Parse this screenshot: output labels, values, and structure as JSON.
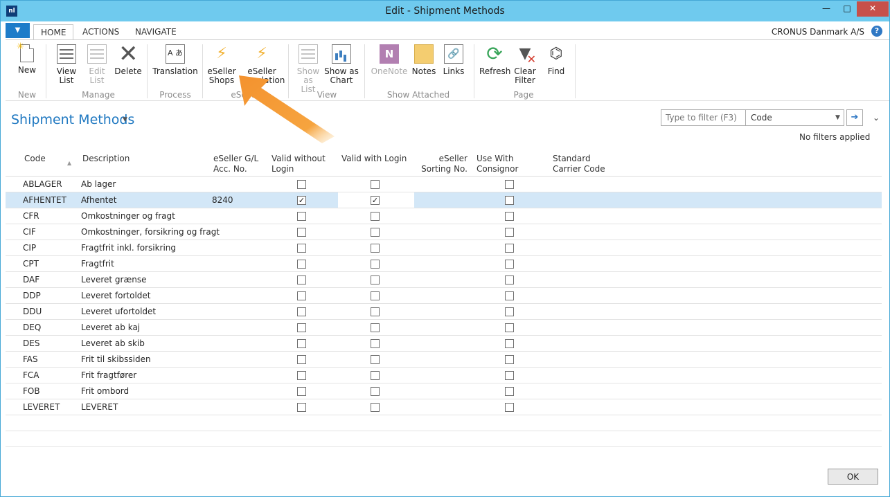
{
  "window": {
    "title": "Edit - Shipment Methods",
    "min_glyph": "—",
    "max_glyph": "□",
    "close_glyph": "✕"
  },
  "tabs": {
    "menu_glyph": "▼",
    "home": "HOME",
    "actions": "ACTIONS",
    "navigate": "NAVIGATE"
  },
  "company": "CRONUS Danmark A/S",
  "help_glyph": "?",
  "ribbon": {
    "new": "New",
    "view_list": [
      "View",
      "List"
    ],
    "edit_list": [
      "Edit",
      "List"
    ],
    "delete": "Delete",
    "translation": "Translation",
    "eseller_shops": [
      "eSeller",
      "Shops"
    ],
    "eseller_translation": [
      "eSeller",
      "Translation"
    ],
    "show_as_list": [
      "Show",
      "as List"
    ],
    "show_as_chart": [
      "Show as",
      "Chart"
    ],
    "onenote": "OneNote",
    "notes": "Notes",
    "links": "Links",
    "refresh": "Refresh",
    "clear_filter": [
      "Clear",
      "Filter"
    ],
    "find": "Find",
    "groups": {
      "new": "New",
      "manage": "Manage",
      "process": "Process",
      "eseller": "eSeller",
      "view": "View",
      "show_attached": "Show Attached",
      "page": "Page"
    },
    "icons": {
      "new": "new-document-icon",
      "view_list": "view-list-icon",
      "edit_list": "edit-list-icon",
      "delete": "delete-x-icon",
      "translation": "translation-icon",
      "eseller": "lightning-bolt-icon",
      "show_as_list": "list-view-icon",
      "show_as_chart": "chart-icon",
      "onenote": "onenote-icon",
      "notes": "sticky-note-icon",
      "links": "link-icon",
      "refresh": "refresh-icon",
      "clear_filter": "clear-filter-icon",
      "find": "binoculars-icon"
    }
  },
  "page": {
    "title": "Shipment Methods",
    "filter": {
      "placeholder": "Type to filter (F3)",
      "field": "Code",
      "status": "No filters applied"
    }
  },
  "grid": {
    "columns": [
      [
        "Code",
        ""
      ],
      [
        "Description",
        ""
      ],
      [
        "eSeller G/L",
        "Acc. No."
      ],
      [
        "Valid without",
        "Login"
      ],
      [
        "Valid with Login",
        ""
      ],
      [
        "eSeller",
        "Sorting No."
      ],
      [
        "Use With",
        "Consignor"
      ],
      [
        "Standard",
        "Carrier Code"
      ]
    ],
    "rows": [
      {
        "code": "ABLAGER",
        "description": "Ab lager",
        "acc_no": "",
        "valid_without_login": false,
        "valid_with_login": false,
        "use_with_consignor": false,
        "selected": false
      },
      {
        "code": "AFHENTET",
        "description": "Afhentet",
        "acc_no": "8240",
        "valid_without_login": true,
        "valid_with_login": true,
        "use_with_consignor": false,
        "selected": true
      },
      {
        "code": "CFR",
        "description": "Omkostninger og fragt",
        "acc_no": "",
        "valid_without_login": false,
        "valid_with_login": false,
        "use_with_consignor": false,
        "selected": false
      },
      {
        "code": "CIF",
        "description": "Omkostninger, forsikring og fragt",
        "acc_no": "",
        "valid_without_login": false,
        "valid_with_login": false,
        "use_with_consignor": false,
        "selected": false
      },
      {
        "code": "CIP",
        "description": "Fragtfrit inkl. forsikring",
        "acc_no": "",
        "valid_without_login": false,
        "valid_with_login": false,
        "use_with_consignor": false,
        "selected": false
      },
      {
        "code": "CPT",
        "description": "Fragtfrit",
        "acc_no": "",
        "valid_without_login": false,
        "valid_with_login": false,
        "use_with_consignor": false,
        "selected": false
      },
      {
        "code": "DAF",
        "description": "Leveret grænse",
        "acc_no": "",
        "valid_without_login": false,
        "valid_with_login": false,
        "use_with_consignor": false,
        "selected": false
      },
      {
        "code": "DDP",
        "description": "Leveret fortoldet",
        "acc_no": "",
        "valid_without_login": false,
        "valid_with_login": false,
        "use_with_consignor": false,
        "selected": false
      },
      {
        "code": "DDU",
        "description": "Leveret ufortoldet",
        "acc_no": "",
        "valid_without_login": false,
        "valid_with_login": false,
        "use_with_consignor": false,
        "selected": false
      },
      {
        "code": "DEQ",
        "description": "Leveret ab kaj",
        "acc_no": "",
        "valid_without_login": false,
        "valid_with_login": false,
        "use_with_consignor": false,
        "selected": false
      },
      {
        "code": "DES",
        "description": "Leveret ab skib",
        "acc_no": "",
        "valid_without_login": false,
        "valid_with_login": false,
        "use_with_consignor": false,
        "selected": false
      },
      {
        "code": "FAS",
        "description": "Frit til skibssiden",
        "acc_no": "",
        "valid_without_login": false,
        "valid_with_login": false,
        "use_with_consignor": false,
        "selected": false
      },
      {
        "code": "FCA",
        "description": "Frit fragtfører",
        "acc_no": "",
        "valid_without_login": false,
        "valid_with_login": false,
        "use_with_consignor": false,
        "selected": false
      },
      {
        "code": "FOB",
        "description": "Frit ombord",
        "acc_no": "",
        "valid_without_login": false,
        "valid_with_login": false,
        "use_with_consignor": false,
        "selected": false
      },
      {
        "code": "LEVERET",
        "description": "LEVERET",
        "acc_no": "",
        "valid_without_login": false,
        "valid_with_login": false,
        "use_with_consignor": false,
        "selected": false
      }
    ]
  },
  "ok_button": "OK",
  "colors": {
    "titlebar": "#6fcaee",
    "accent": "#1f78c1",
    "selected_row": "#d3e7f7",
    "highlight_arrow": "#f4922e"
  }
}
